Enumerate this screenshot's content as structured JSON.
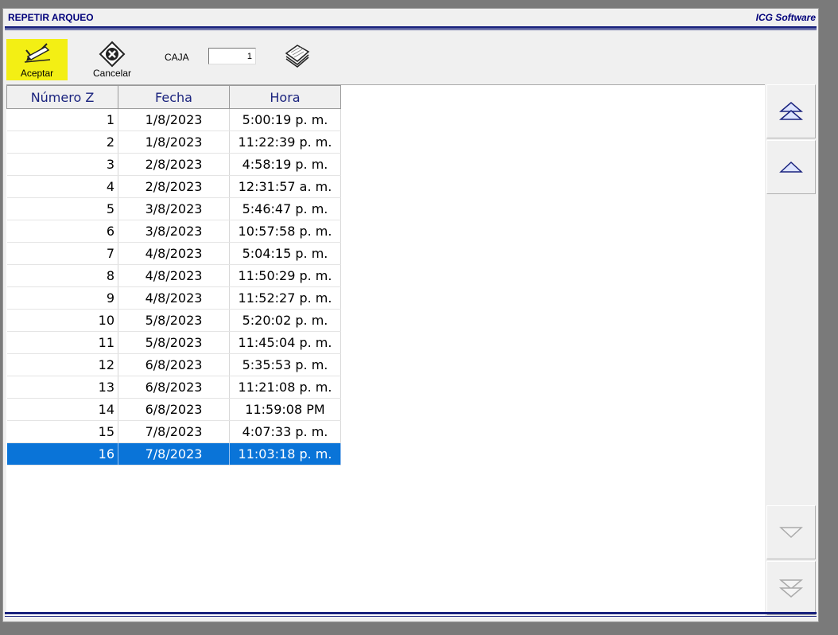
{
  "window": {
    "title": "REPETIR ARQUEO",
    "brand": "ICG Software"
  },
  "toolbar": {
    "accept_label": "Aceptar",
    "cancel_label": "Cancelar",
    "caja_label": "CAJA",
    "caja_value": "1",
    "accept_icon": "pencil-check-icon",
    "cancel_icon": "cancel-x-icon",
    "caja_icon": "documents-icon"
  },
  "grid": {
    "columns": [
      "Número Z",
      "Fecha",
      "Hora"
    ],
    "rows": [
      {
        "z": "1",
        "fecha": "1/8/2023",
        "hora": "5:00:19 p. m."
      },
      {
        "z": "2",
        "fecha": "1/8/2023",
        "hora": "11:22:39 p. m."
      },
      {
        "z": "3",
        "fecha": "2/8/2023",
        "hora": "4:58:19 p. m."
      },
      {
        "z": "4",
        "fecha": "2/8/2023",
        "hora": "12:31:57 a. m."
      },
      {
        "z": "5",
        "fecha": "3/8/2023",
        "hora": "5:46:47 p. m."
      },
      {
        "z": "6",
        "fecha": "3/8/2023",
        "hora": "10:57:58 p. m."
      },
      {
        "z": "7",
        "fecha": "4/8/2023",
        "hora": "5:04:15 p. m."
      },
      {
        "z": "8",
        "fecha": "4/8/2023",
        "hora": "11:50:29 p. m."
      },
      {
        "z": "9",
        "fecha": "4/8/2023",
        "hora": "11:52:27 p. m."
      },
      {
        "z": "10",
        "fecha": "5/8/2023",
        "hora": "5:20:02 p. m."
      },
      {
        "z": "11",
        "fecha": "5/8/2023",
        "hora": "11:45:04 p. m."
      },
      {
        "z": "12",
        "fecha": "6/8/2023",
        "hora": "5:35:53 p. m."
      },
      {
        "z": "13",
        "fecha": "6/8/2023",
        "hora": "11:21:08 p. m."
      },
      {
        "z": "14",
        "fecha": "6/8/2023",
        "hora": "11:59:08 PM"
      },
      {
        "z": "15",
        "fecha": "7/8/2023",
        "hora": "4:07:33 p. m."
      },
      {
        "z": "16",
        "fecha": "7/8/2023",
        "hora": "11:03:18 p. m."
      }
    ],
    "selected_row": 16
  },
  "scroll_buttons": [
    "page-up-icon",
    "line-up-icon",
    "line-down-icon",
    "page-down-icon"
  ],
  "colors": {
    "title_text": "#00007a",
    "rule": "#1a237e",
    "accept_highlight": "#f3ef14",
    "selection": "#0a74d8"
  }
}
